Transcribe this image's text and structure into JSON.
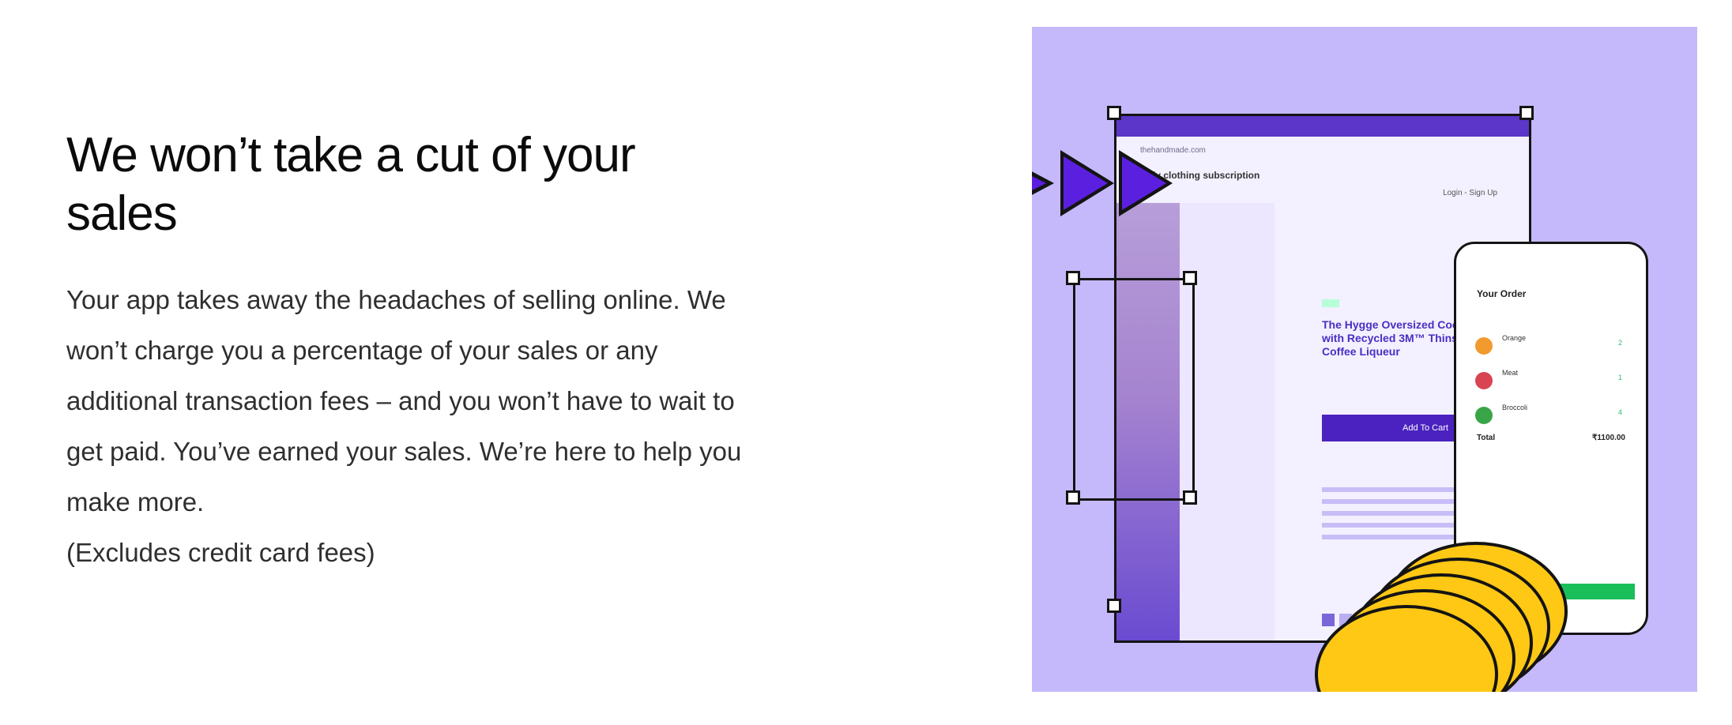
{
  "headline": "We won’t take a cut of your sales",
  "body": "Your app takes away the headaches of selling online. We won’t charge you a percentage of your sales or any additional transaction fees – and you won’t have to wait to get paid. You’ve earned your sales. We’re here to help you make more.",
  "note": "(Excludes credit card fees)",
  "illustration": {
    "background": "#c5b9fb",
    "browser": {
      "url": "thehandmade.com",
      "brand": "Monthly clothing subscription",
      "login": "Login - Sign Up",
      "product_title": "The Hygge Oversized Cocoon Coat with Recycled 3M™ Thinsulate™ Coffee Liqueur",
      "cta": "Add To Cart"
    },
    "phone": {
      "title": "Your Order",
      "items": [
        {
          "name": "Orange",
          "qty": "2",
          "color": "#f29a2e"
        },
        {
          "name": "Meat",
          "qty": "1",
          "color": "#d94452"
        },
        {
          "name": "Broccoli",
          "qty": "4",
          "color": "#3aa548"
        }
      ],
      "total_label": "Total",
      "total_value": "₹1100.00"
    },
    "accent": "#5b36c9",
    "coin_color": "#ffc814"
  }
}
